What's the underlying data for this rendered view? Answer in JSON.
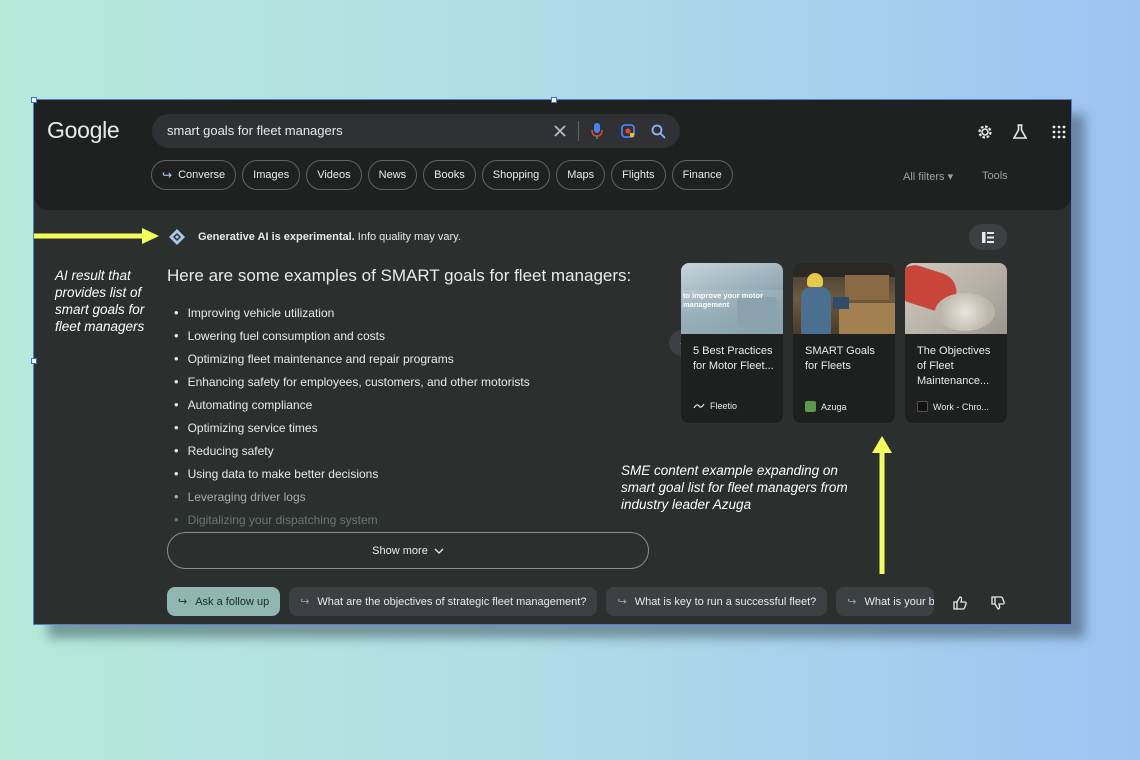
{
  "logo": "Google",
  "search": {
    "query": "smart goals for fleet managers"
  },
  "icons": {
    "clear": "close-icon",
    "mic": "mic-icon",
    "lens": "lens-icon",
    "search": "search-icon",
    "settings": "gear-icon",
    "labs": "flask-icon",
    "apps": "apps-grid-icon"
  },
  "chips": [
    {
      "label": "Converse",
      "arrow": "↪"
    },
    {
      "label": "Images"
    },
    {
      "label": "Videos"
    },
    {
      "label": "News"
    },
    {
      "label": "Books"
    },
    {
      "label": "Shopping"
    },
    {
      "label": "Maps"
    },
    {
      "label": "Flights"
    },
    {
      "label": "Finance"
    }
  ],
  "filters": {
    "all_filters": "All filters",
    "tools": "Tools"
  },
  "ai": {
    "notice_bold": "Generative AI is experimental.",
    "notice_rest": " Info quality may vary.",
    "title": "Here are some examples of SMART goals for fleet managers:",
    "items": [
      "Improving vehicle utilization",
      "Lowering fuel consumption and costs",
      "Optimizing fleet maintenance and repair programs",
      "Enhancing safety for employees, customers, and other motorists",
      "Automating compliance",
      "Optimizing service times",
      "Reducing safety",
      "Using data to make better decisions",
      "Leveraging driver logs",
      "Digitalizing your dispatching system"
    ],
    "show_more": "Show more"
  },
  "cards": [
    {
      "overlay": "to improve your motor management",
      "title": "5 Best Practices for Motor Fleet...",
      "source": "Fleetio",
      "color": "#7c9aa6"
    },
    {
      "title": "SMART Goals for Fleets",
      "source": "Azuga",
      "color": "#7d6a4a"
    },
    {
      "title": "The Objectives of Fleet Maintenance...",
      "source": "Work - Chro...",
      "color": "#c0574a"
    }
  ],
  "followups": [
    {
      "label": "Ask a follow up",
      "arrow": "↪"
    },
    {
      "label": "What are the objectives of strategic fleet management?",
      "arrow": "↪"
    },
    {
      "label": "What is key to run a successful fleet?",
      "arrow": "↪"
    },
    {
      "label": "What is your b",
      "arrow": "↪"
    }
  ],
  "annotations": {
    "left": "AI result that provides list of smart goals for fleet managers",
    "bottom": "SME content example expanding on smart goal list for fleet managers from industry leader Azuga",
    "arrow_color": "#f3ff5a"
  },
  "colors": {
    "background": "#2b302e",
    "header": "#1f2120",
    "text": "#e8eaed",
    "accent_blue": "#8ab4f8"
  }
}
